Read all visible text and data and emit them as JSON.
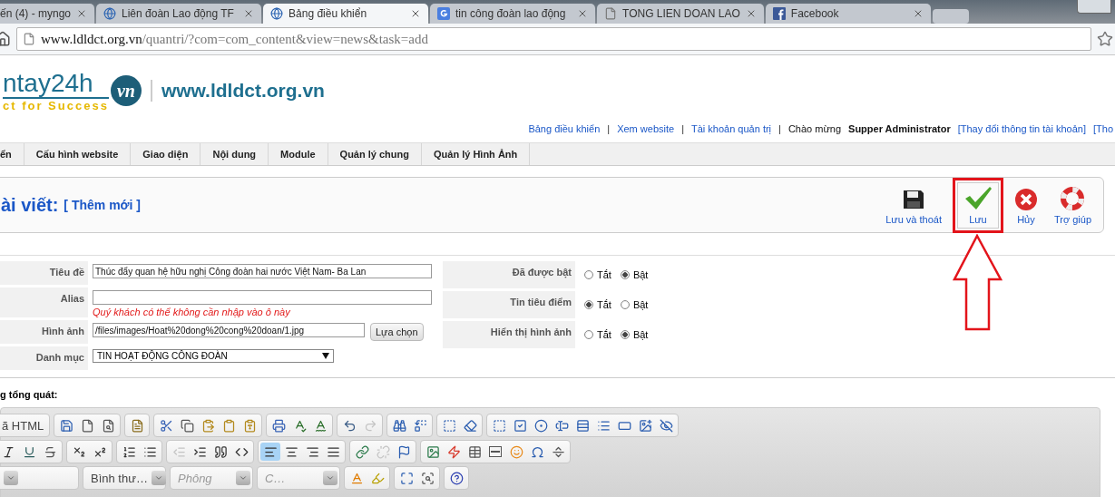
{
  "browser": {
    "tabs": [
      {
        "title": "ến (4) - myngo",
        "kind": "none",
        "selected": false
      },
      {
        "title": "Liên đoàn Lao động TF",
        "kind": "globe",
        "selected": false
      },
      {
        "title": "Bảng điều khiển",
        "kind": "globe",
        "selected": true
      },
      {
        "title": "tin công đoàn lao động",
        "kind": "google",
        "selected": false
      },
      {
        "title": "TONG LIEN DOAN LAO",
        "kind": "page",
        "selected": false
      },
      {
        "title": "Facebook",
        "kind": "facebook",
        "selected": false
      }
    ],
    "address": {
      "host": "www.ldldct.org.vn",
      "path": "/quantri/?com=com_content&view=news&task=add"
    }
  },
  "header": {
    "logo": {
      "name": "ntay24h",
      "badge": "vn",
      "slogan": "ct for Success"
    },
    "site": "www.ldldct.org.vn",
    "links": [
      {
        "kind": "link",
        "text": "Bảng điều khiển"
      },
      {
        "kind": "sep",
        "text": "|"
      },
      {
        "kind": "link",
        "text": "Xem website"
      },
      {
        "kind": "sep",
        "text": "|"
      },
      {
        "kind": "link",
        "text": "Tài khoản quản trị"
      },
      {
        "kind": "sep",
        "text": "|"
      },
      {
        "kind": "plain",
        "text": "Chào mừng"
      },
      {
        "kind": "strong",
        "text": "Supper Administrator"
      },
      {
        "kind": "link",
        "text": "[Thay đổi thông tin tài khoản]"
      },
      {
        "kind": "link",
        "text": "[Tho"
      }
    ]
  },
  "menu": [
    "ển",
    "Cấu hình website",
    "Giao diện",
    "Nội dung",
    "Module",
    "Quản lý chung",
    "Quản lý Hình Ảnh"
  ],
  "page_title": {
    "title": "ài viết:",
    "subtitle": "[ Thêm mới ]"
  },
  "actions": [
    {
      "kind": "save-close",
      "label": "Lưu và thoát",
      "highlighted": false
    },
    {
      "kind": "save",
      "label": "Lưu",
      "highlighted": true
    },
    {
      "kind": "cancel",
      "label": "Hủy",
      "highlighted": false
    },
    {
      "kind": "help",
      "label": "Trợ giúp",
      "highlighted": false
    }
  ],
  "form": {
    "fields": [
      {
        "kind": "text",
        "label": "Tiêu đề",
        "value": "Thúc đẩy quan hệ hữu nghị Công đoàn hai nước Việt Nam- Ba Lan"
      },
      {
        "kind": "text",
        "label": "Alias",
        "hint": "Quý khách có thể không cần nhập vào ô này"
      },
      {
        "kind": "file",
        "label": "Hình ảnh",
        "value": "/files/images/Hoat%20dong%20cong%20doan/1.jpg",
        "button": "Lựa chọn"
      },
      {
        "kind": "select",
        "label": "Danh mục",
        "value": "TIN HOẠT ĐỘNG CÔNG ĐOÀN"
      }
    ],
    "options": [
      {
        "label": "Đã được bật",
        "choices": [
          {
            "label": "Tắt",
            "selected": false
          },
          {
            "label": "Bật",
            "selected": true
          }
        ]
      },
      {
        "label": "Tin tiêu điểm",
        "choices": [
          {
            "label": "Tắt",
            "selected": true
          },
          {
            "label": "Bật",
            "selected": false
          }
        ]
      },
      {
        "label": "Hiển thị hình ảnh",
        "choices": [
          {
            "label": "Tắt",
            "selected": false
          },
          {
            "label": "Bật",
            "selected": true
          }
        ]
      }
    ]
  },
  "editor": {
    "label": "g tổng quát:",
    "rows": [
      [
        [
          {
            "kind": "source",
            "label": "ã HTML",
            "disabled": false
          }
        ],
        [
          {
            "kind": "save",
            "disabled": false
          },
          {
            "kind": "newpage",
            "disabled": false
          },
          {
            "kind": "preview",
            "disabled": false
          }
        ],
        [
          {
            "kind": "templates",
            "disabled": false
          }
        ],
        [
          {
            "kind": "cut",
            "disabled": false
          },
          {
            "kind": "copy",
            "disabled": false
          },
          {
            "kind": "paste",
            "disabled": false
          },
          {
            "kind": "pastetext",
            "disabled": false
          },
          {
            "kind": "pasteword",
            "disabled": false
          }
        ],
        [
          {
            "kind": "print",
            "disabled": false
          },
          {
            "kind": "spell",
            "disabled": false
          },
          {
            "kind": "spellmenu",
            "disabled": false
          }
        ],
        [
          {
            "kind": "undo",
            "disabled": false
          },
          {
            "kind": "redo",
            "disabled": true
          }
        ],
        [
          {
            "kind": "find",
            "disabled": false
          },
          {
            "kind": "replace",
            "disabled": false
          }
        ],
        [
          {
            "kind": "selectall",
            "disabled": false
          },
          {
            "kind": "removeformat",
            "disabled": false
          }
        ],
        [
          {
            "kind": "form",
            "disabled": false
          },
          {
            "kind": "checkbox",
            "disabled": false
          },
          {
            "kind": "radio",
            "disabled": false
          },
          {
            "kind": "textfield",
            "disabled": false
          },
          {
            "kind": "textarea",
            "disabled": false
          },
          {
            "kind": "select",
            "disabled": false
          },
          {
            "kind": "button",
            "disabled": false
          },
          {
            "kind": "imagebutton",
            "disabled": false
          },
          {
            "kind": "hidden",
            "disabled": false
          }
        ]
      ],
      [
        [
          {
            "kind": "italic",
            "disabled": false
          },
          {
            "kind": "underline",
            "disabled": false
          },
          {
            "kind": "strike",
            "disabled": false
          }
        ],
        [
          {
            "kind": "subscript",
            "disabled": false
          },
          {
            "kind": "superscript",
            "disabled": false
          }
        ],
        [
          {
            "kind": "ol",
            "disabled": false
          },
          {
            "kind": "ul",
            "disabled": false
          }
        ],
        [
          {
            "kind": "outdent",
            "disabled": true
          },
          {
            "kind": "indent",
            "disabled": false
          },
          {
            "kind": "quote",
            "disabled": false
          },
          {
            "kind": "div",
            "disabled": false
          }
        ],
        [
          {
            "kind": "alignleft",
            "disabled": false,
            "selected": true
          },
          {
            "kind": "aligncenter",
            "disabled": false,
            "selected": false
          },
          {
            "kind": "alignright",
            "disabled": false,
            "selected": false
          },
          {
            "kind": "justify",
            "disabled": false,
            "selected": false
          }
        ],
        [
          {
            "kind": "link",
            "disabled": false
          },
          {
            "kind": "unlink",
            "disabled": true
          },
          {
            "kind": "anchor",
            "disabled": false
          }
        ],
        [
          {
            "kind": "image",
            "disabled": false
          },
          {
            "kind": "flash",
            "disabled": false
          },
          {
            "kind": "table",
            "disabled": false
          },
          {
            "kind": "hr",
            "disabled": false
          },
          {
            "kind": "smiley",
            "disabled": false
          },
          {
            "kind": "special",
            "disabled": false
          },
          {
            "kind": "pagebreak",
            "disabled": false
          }
        ]
      ],
      [
        [
          {
            "kind": "combo"
          }
        ],
        [
          {
            "kind": "combo",
            "value": "Bình thư…"
          }
        ],
        [
          {
            "kind": "combo",
            "placeholder": "Phông"
          }
        ],
        [
          {
            "kind": "combo",
            "placeholder": "C…"
          }
        ],
        [
          {
            "kind": "textcolor",
            "disabled": false
          },
          {
            "kind": "bgcolor",
            "disabled": false
          }
        ],
        [
          {
            "kind": "maximize",
            "disabled": false
          },
          {
            "kind": "showblocks",
            "disabled": false
          }
        ],
        [
          {
            "kind": "about",
            "disabled": false
          }
        ]
      ]
    ]
  }
}
